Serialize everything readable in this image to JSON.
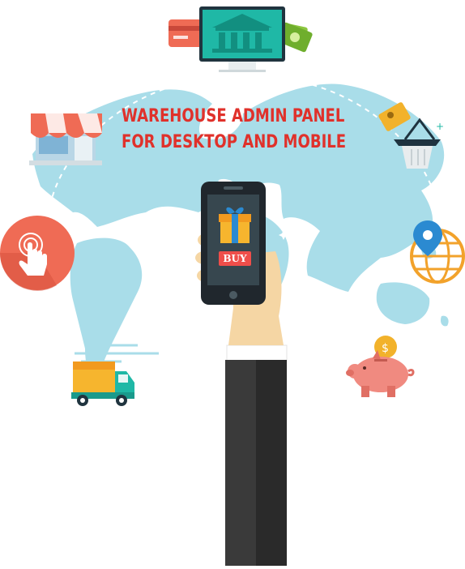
{
  "headline": {
    "line1": "WAREHOUSE ADMIN PANEL",
    "line2": "FOR DESKTOP AND MOBILE"
  },
  "phone": {
    "button_label": "BUY"
  },
  "colors": {
    "title_red": "#e0312b",
    "map_blue": "#a9dde9",
    "teal": "#1fb8a6",
    "orange": "#f2a22b",
    "coral": "#ef6b55"
  },
  "icons": [
    "bank-icon",
    "credit-card-icon",
    "cash-icon",
    "storefront-icon",
    "payment-card-icon",
    "shopping-basket-icon",
    "tap-hand-icon",
    "location-globe-icon",
    "delivery-truck-icon",
    "piggy-bank-icon",
    "gift-box-icon"
  ]
}
